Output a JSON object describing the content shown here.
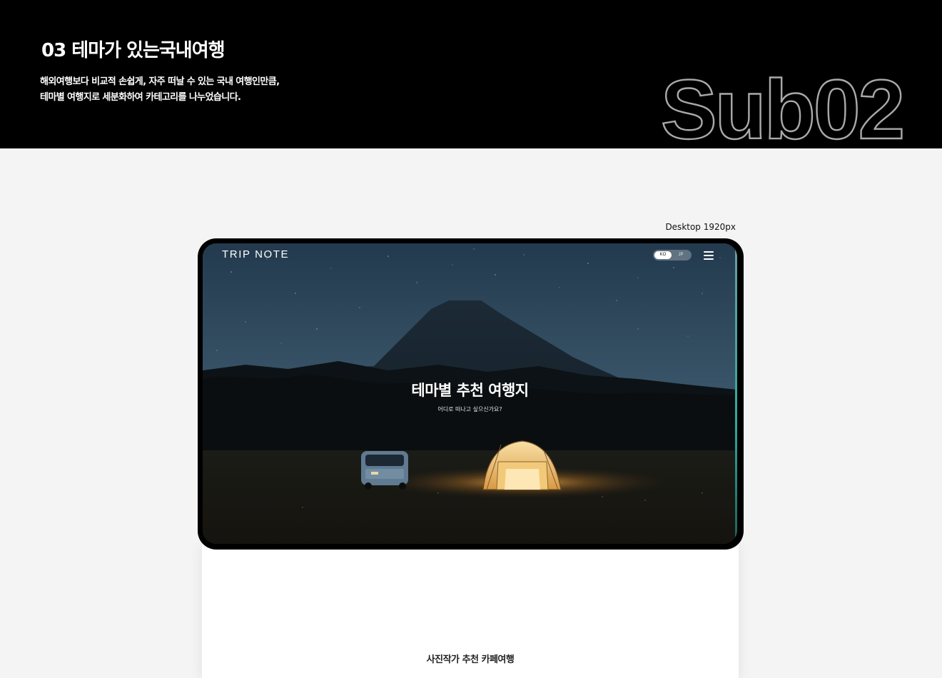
{
  "section": {
    "title": "03 테마가 있는국내여행",
    "description_lines": [
      "해외여행보다 비교적 손쉽게, 자주 떠날 수 있는 국내 여행인만큼,",
      "테마별 여행지로 세분화하여 카테고리를 나누었습니다."
    ],
    "sub_mark": "Sub02"
  },
  "viewport_label": "Desktop 1920px",
  "site": {
    "logo": "TRIP NOTE",
    "languages": [
      "KO",
      "JP"
    ],
    "selected_language": "KO",
    "menu_icon": "hamburger-menu-icon",
    "hero": {
      "title": "테마별 추천 여행지",
      "subtitle": "어디로 떠나고 싶으신가요?",
      "image": "mountain-camp-night-photo"
    }
  },
  "next_section_caption": "사진작가 추천 카페여행",
  "colors": {
    "banner_background": "#000000",
    "page_background": "#f4f4f4",
    "outline_text": "#a9a9a9",
    "device_frame": "#000000",
    "screen_edge_accent": "#2fa89a"
  }
}
